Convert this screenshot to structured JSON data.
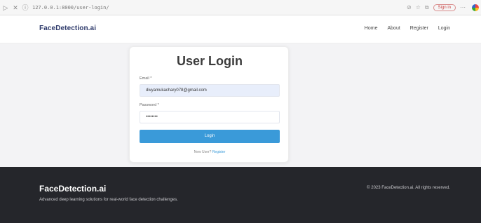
{
  "browser": {
    "url": "127.0.0.1:8000/user-login/",
    "signin_label": "Sign in"
  },
  "navbar": {
    "brand": "FaceDetection.ai",
    "links": [
      "Home",
      "About",
      "Register",
      "Login"
    ]
  },
  "login": {
    "title": "User Login",
    "email_label": "Email *",
    "email_value": "divyamukachary078@gmail.com",
    "password_label": "Password *",
    "password_value": "••••••••",
    "button_label": "Login",
    "register_prompt": "New User?",
    "register_link": "Register"
  },
  "footer": {
    "brand": "FaceDetection.ai",
    "tagline": "Advanced deep learning solutions for real-world face detection challenges.",
    "copyright": "© 2023 FaceDetection.ai. All rights reserved."
  },
  "colors": {
    "brand": "#2e3a6b",
    "accent": "#3a9ad9",
    "footer_bg": "#25262b"
  }
}
